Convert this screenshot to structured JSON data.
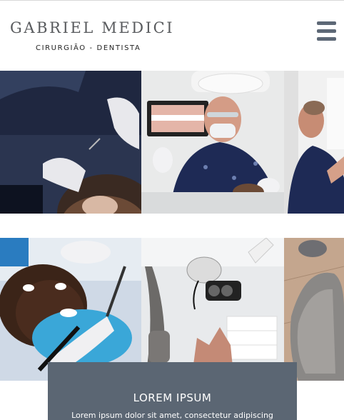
{
  "header": {
    "brand_name": "GABRIEL MEDICI",
    "brand_tagline": "CIRURGIÃO - DENTISTA",
    "menu_icon": "hamburger-menu-icon"
  },
  "gallery": {
    "row1": [
      {
        "photo": "dentist-treating-patient-photo"
      },
      {
        "photo": "dentist-with-mask-photo"
      },
      {
        "photo": "dentist-profile-photo"
      }
    ],
    "row2": [
      {
        "photo": "patient-dental-exam-photo"
      },
      {
        "photo": "dental-chair-lamp-photo"
      },
      {
        "photo": "dental-chair-closeup-photo"
      }
    ]
  },
  "info_card": {
    "title": "LOREM IPSUM",
    "text": "Lorem ipsum dolor sit amet, consectetur adipiscing"
  },
  "colors": {
    "brand_text": "#595b5e",
    "menu_icon": "#5d6876",
    "card_background": "#5b6673"
  }
}
